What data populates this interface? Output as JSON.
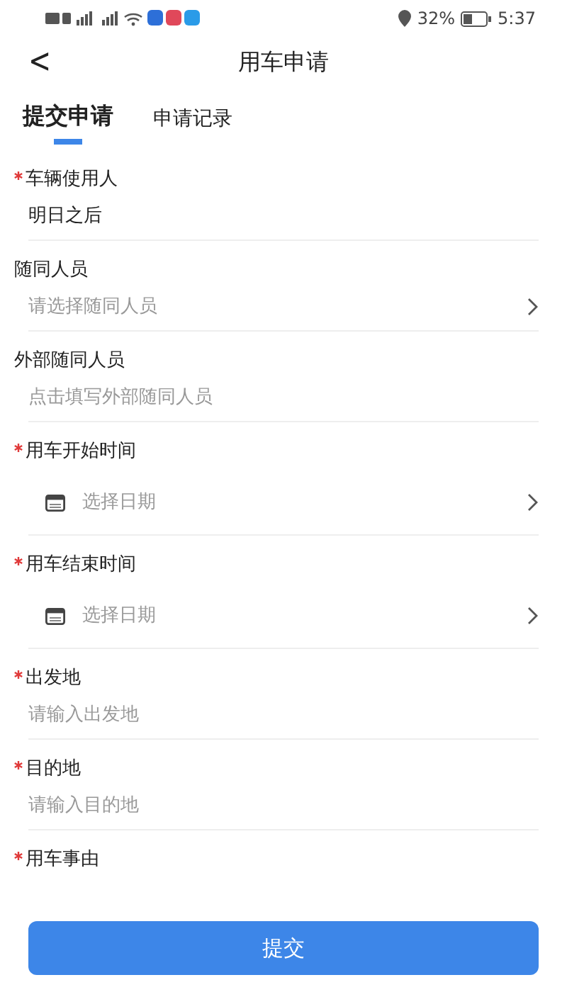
{
  "status_bar": {
    "battery": "32%",
    "time": "5:37"
  },
  "header": {
    "back": "<",
    "title": "用车申请"
  },
  "tabs": [
    {
      "label": "提交申请",
      "selected": true
    },
    {
      "label": "申请记录",
      "selected": false
    }
  ],
  "fields": [
    {
      "kind": "text",
      "label": "车辆使用人",
      "required": true,
      "value": "明日之后"
    },
    {
      "kind": "picker",
      "label": "随同人员",
      "required": false,
      "placeholder": "请选择随同人员"
    },
    {
      "kind": "text",
      "label": "外部随同人员",
      "required": false,
      "placeholder": "点击填写外部随同人员"
    },
    {
      "kind": "date",
      "label": "用车开始时间",
      "required": true,
      "placeholder": "选择日期"
    },
    {
      "kind": "date",
      "label": "用车结束时间",
      "required": true,
      "placeholder": "选择日期"
    },
    {
      "kind": "text",
      "label": "出发地",
      "required": true,
      "placeholder": "请输入出发地"
    },
    {
      "kind": "text",
      "label": "目的地",
      "required": true,
      "placeholder": "请输入目的地"
    },
    {
      "kind": "label",
      "label": "用车事由",
      "required": true
    }
  ],
  "submit": "提交"
}
